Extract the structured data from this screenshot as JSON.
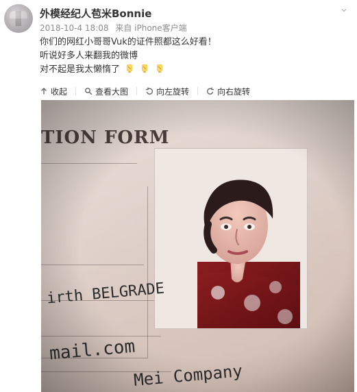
{
  "post": {
    "author": "外模经纪人苞米Bonnie",
    "time": "2018-10-4 18:08",
    "source": "来自 iPhone客户端",
    "lines": [
      "你们的网红小哥哥Vuk的证件照都这么好看！",
      "听说好多人来翻我的微博",
      "对不起是我太懒惰了"
    ],
    "emoji_count": 3,
    "menu_icon": "chevron-down-icon"
  },
  "toolbar": {
    "collapse_label": "收起",
    "view_large_label": "查看大图",
    "rotate_left_label": "向左旋转",
    "rotate_right_label": "向右旋转"
  },
  "image": {
    "form_title": "TION FORM",
    "handwrite_birth": "irth BELGRADE",
    "handwrite_email": "mail.com",
    "handwrite_company": "Mei Company"
  }
}
